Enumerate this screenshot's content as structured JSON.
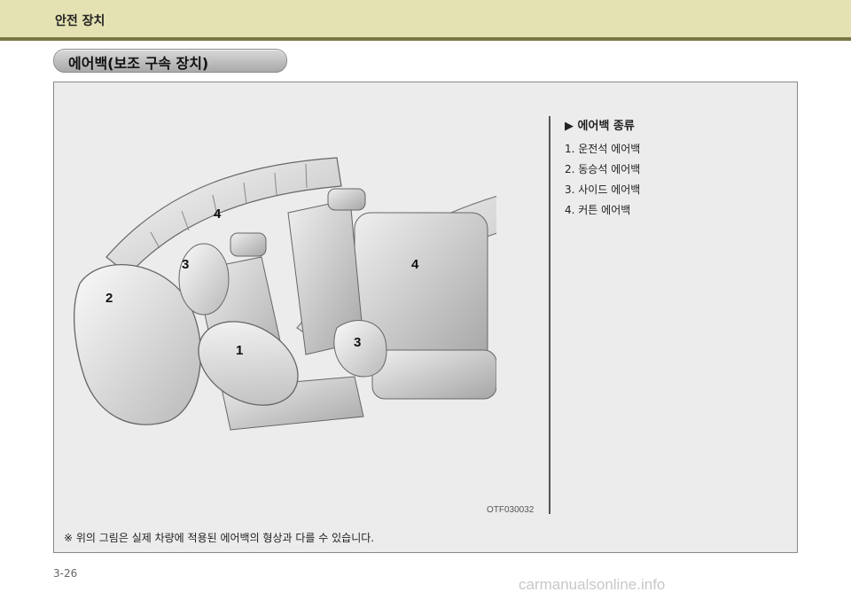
{
  "header": {
    "title": "안전 장치"
  },
  "section": {
    "title": "에어백(보조 구속 장치)"
  },
  "figure": {
    "callouts": [
      "4",
      "3",
      "2",
      "1",
      "3",
      "4"
    ],
    "image_code": "OTF030032"
  },
  "airbag_types": {
    "heading": "에어백 종류",
    "items": [
      "1.  운전석 에어백",
      "2.  동승석 에어백",
      "3.  사이드 에어백",
      "4.  커튼 에어백"
    ]
  },
  "footnote": "※ 위의 그림은 실제 차량에 적용된 에어백의 형상과 다를 수 있습니다.",
  "page_number": "3-26",
  "watermark": "carmanualsonline.info",
  "colors": {
    "header_band": "#e4e2b2",
    "header_line": "#7a7644",
    "panel_bg": "#ececec"
  }
}
